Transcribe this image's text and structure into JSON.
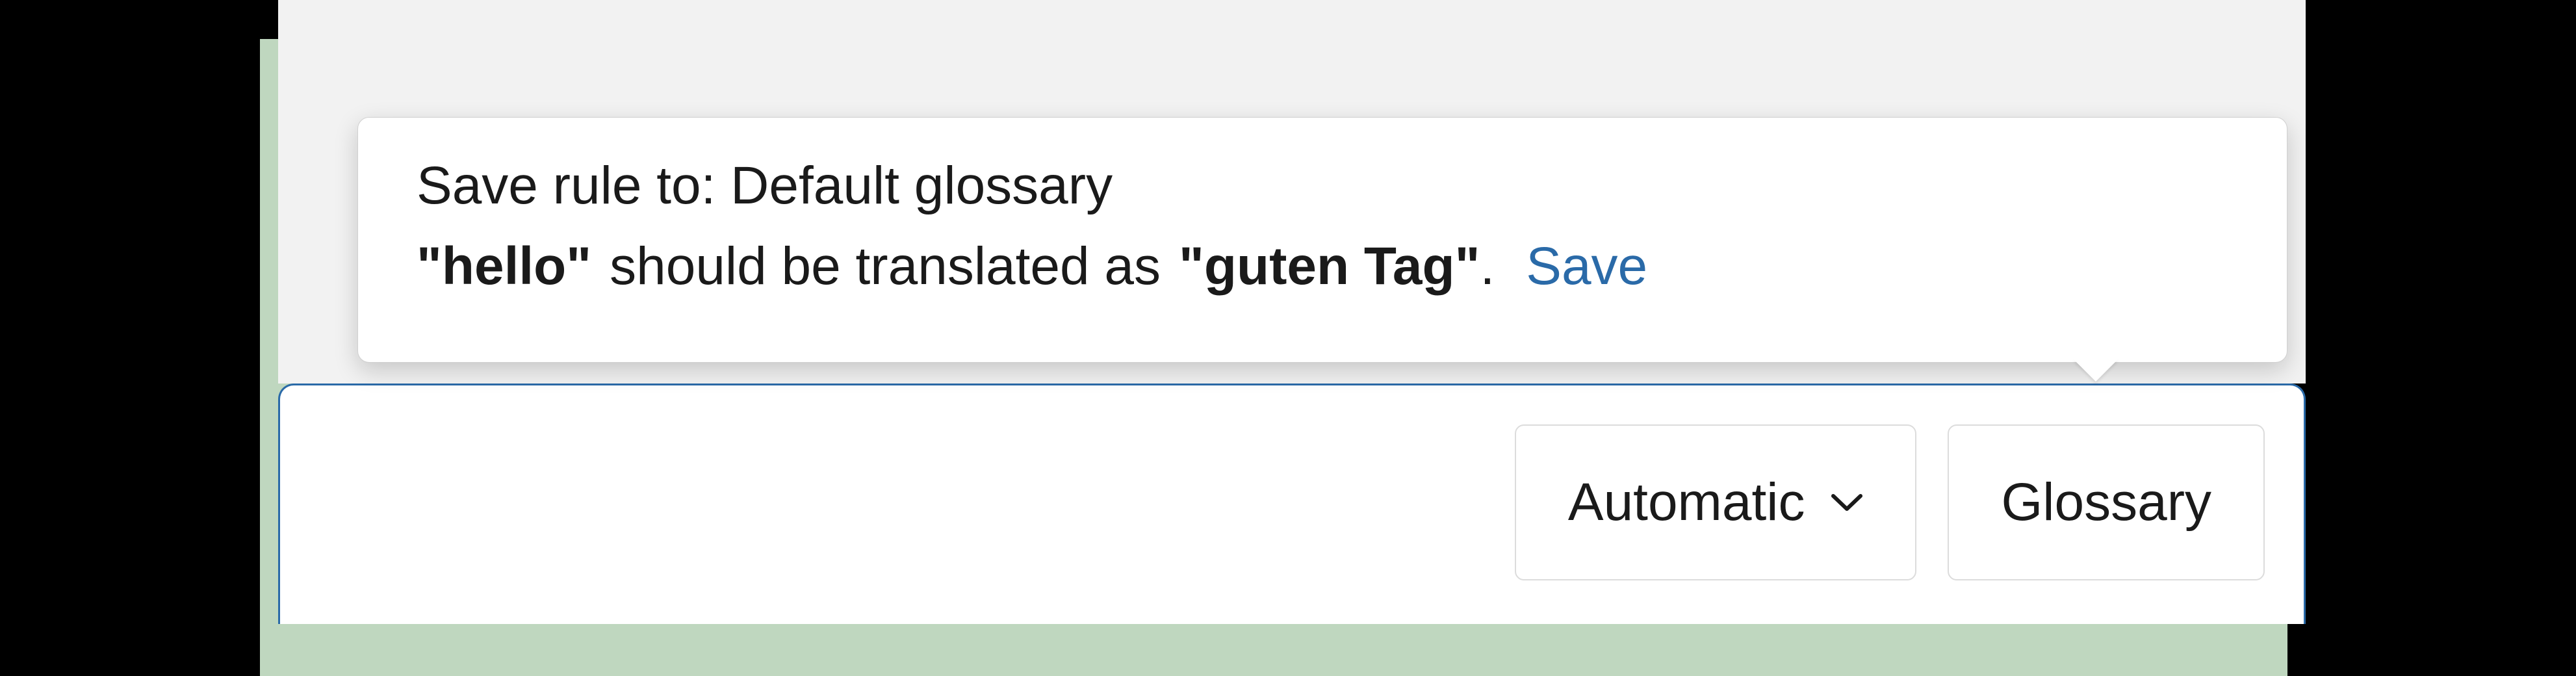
{
  "popover": {
    "header_prefix": "Save rule to: ",
    "glossary_name": "Default glossary",
    "source_term": "\"hello\"",
    "mid_text": "should be translated as",
    "target_term": "\"guten Tag\"",
    "period": ".",
    "save_label": "Save"
  },
  "toolbar": {
    "style_label": "Automatic",
    "glossary_label": "Glossary"
  }
}
